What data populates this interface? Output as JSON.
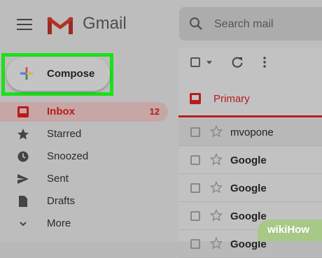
{
  "header": {
    "app_name": "Gmail",
    "search_placeholder": "Search mail"
  },
  "compose": {
    "label": "Compose",
    "highlight_color": "#1be01b"
  },
  "sidebar": {
    "items": [
      {
        "label": "Inbox",
        "count": "12",
        "icon": "inbox-icon",
        "active": true
      },
      {
        "label": "Starred",
        "icon": "star-icon"
      },
      {
        "label": "Snoozed",
        "icon": "clock-icon"
      },
      {
        "label": "Sent",
        "icon": "send-icon"
      },
      {
        "label": "Drafts",
        "icon": "draft-icon"
      },
      {
        "label": "More",
        "icon": "chevron-down-icon"
      }
    ]
  },
  "main": {
    "tab": {
      "label": "Primary",
      "icon": "inbox-icon"
    },
    "emails": [
      {
        "sender": "mvopone",
        "bold": false
      },
      {
        "sender": "Google",
        "bold": true
      },
      {
        "sender": "Google",
        "bold": true
      },
      {
        "sender": "Google",
        "bold": true
      },
      {
        "sender": "Google",
        "bold": true
      }
    ]
  },
  "watermark": {
    "text": "wikiHow"
  },
  "colors": {
    "accent_red": "#b71c1c",
    "highlight_green": "#1be01b"
  }
}
